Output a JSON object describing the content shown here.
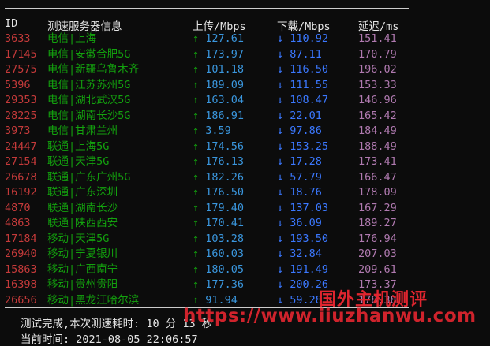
{
  "header": {
    "id": "ID",
    "server": "测速服务器信息",
    "upload": "上传/Mbps",
    "download": "下载/Mbps",
    "latency": "延迟/ms"
  },
  "arrows": {
    "up": "↑",
    "down": "↓"
  },
  "rows": [
    {
      "id": "3633",
      "server": "电信|上海",
      "up": "127.61",
      "down": "110.92",
      "lat": "151.41"
    },
    {
      "id": "17145",
      "server": "电信|安徽合肥5G",
      "up": "173.97",
      "down": "87.11",
      "lat": "170.79"
    },
    {
      "id": "27575",
      "server": "电信|新疆乌鲁木齐",
      "up": "101.18",
      "down": "116.50",
      "lat": "196.02"
    },
    {
      "id": "5396",
      "server": "电信|江苏苏州5G",
      "up": "189.09",
      "down": "111.55",
      "lat": "153.33"
    },
    {
      "id": "29353",
      "server": "电信|湖北武汉5G",
      "up": "163.04",
      "down": "108.47",
      "lat": "146.96"
    },
    {
      "id": "28225",
      "server": "电信|湖南长沙5G",
      "up": "186.91",
      "down": "22.01",
      "lat": "165.42"
    },
    {
      "id": "3973",
      "server": "电信|甘肃兰州",
      "up": "3.59",
      "down": "97.86",
      "lat": "184.49"
    },
    {
      "id": "24447",
      "server": "联通|上海5G",
      "up": "174.56",
      "down": "153.25",
      "lat": "188.49"
    },
    {
      "id": "27154",
      "server": "联通|天津5G",
      "up": "176.13",
      "down": "17.28",
      "lat": "173.41"
    },
    {
      "id": "26678",
      "server": "联通|广东广州5G",
      "up": "182.26",
      "down": "57.79",
      "lat": "166.47"
    },
    {
      "id": "16192",
      "server": "联通|广东深圳",
      "up": "176.50",
      "down": "18.76",
      "lat": "178.09"
    },
    {
      "id": "4870",
      "server": "联通|湖南长沙",
      "up": "179.40",
      "down": "137.03",
      "lat": "167.29"
    },
    {
      "id": "4863",
      "server": "联通|陕西西安",
      "up": "170.41",
      "down": "36.09",
      "lat": "189.27"
    },
    {
      "id": "17184",
      "server": "移动|天津5G",
      "up": "103.28",
      "down": "193.50",
      "lat": "176.94"
    },
    {
      "id": "26940",
      "server": "移动|宁夏银川",
      "up": "160.03",
      "down": "32.84",
      "lat": "207.03"
    },
    {
      "id": "15863",
      "server": "移动|广西南宁",
      "up": "180.05",
      "down": "191.49",
      "lat": "209.61"
    },
    {
      "id": "16398",
      "server": "移动|贵州贵阳",
      "up": "177.36",
      "down": "200.26",
      "lat": "173.37"
    },
    {
      "id": "26656",
      "server": "移动|黑龙江哈尔滨",
      "up": "91.94",
      "down": "59.28",
      "lat": "178.38"
    }
  ],
  "footer": {
    "done": "测试完成,本次测速耗时: 10 分 13 秒",
    "time": "当前时间: 2021-08-05 22:06:57"
  },
  "watermark": {
    "site_name": "国外主机测评",
    "url": "https://www.iiuzhanwu.com"
  },
  "colors": {
    "background": "#0c0c0c",
    "id": "#c43a3a",
    "server": "#13a10e",
    "upload": "#3a96dd",
    "download": "#3b78ff",
    "latency": "#b07ab0",
    "watermark": "#e0252f"
  }
}
